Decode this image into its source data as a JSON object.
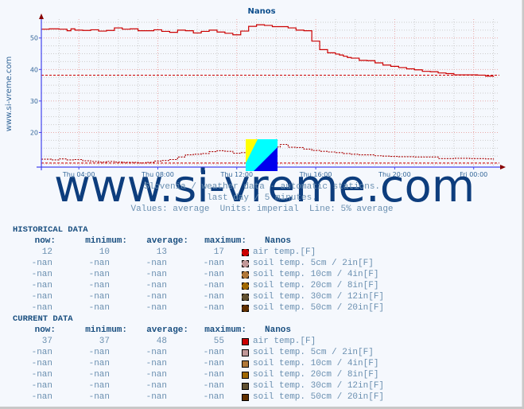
{
  "chart_data": {
    "type": "line",
    "title": "Nanos",
    "side_label": "www.si-vreme.com",
    "ylim": [
      9,
      56
    ],
    "yticks": [
      20,
      30,
      40,
      50
    ],
    "x_ticks": [
      "Thu 04:00",
      "Thu 08:00",
      "Thu 12:00",
      "Thu 16:00",
      "Thu 20:00",
      "Fri 00:00"
    ],
    "x_tick_hours": [
      4,
      8,
      12,
      16,
      20,
      24
    ],
    "x_range_hours": [
      2.1,
      25.3
    ],
    "grid": true,
    "series": [
      {
        "name": "air temp. current",
        "style": "solid",
        "color": "#cc0000",
        "hours": [
          2.1,
          2.5,
          3.0,
          3.4,
          3.6,
          3.8,
          4.2,
          4.6,
          5.0,
          5.4,
          5.8,
          6.2,
          6.6,
          7.0,
          7.4,
          7.8,
          8.2,
          8.6,
          9.0,
          9.4,
          9.8,
          10.2,
          10.6,
          11.0,
          11.4,
          11.8,
          12.2,
          12.6,
          13.0,
          13.4,
          13.8,
          14.2,
          14.6,
          15.0,
          15.4,
          15.8,
          16.2,
          16.6,
          17.0,
          17.2,
          17.4,
          17.6,
          17.8,
          18.2,
          18.6,
          19.0,
          19.4,
          19.8,
          20.2,
          20.6,
          21.0,
          21.4,
          21.8,
          22.2,
          22.6,
          23.0,
          23.4,
          23.8,
          24.2,
          24.6,
          25.0
        ],
        "values": [
          52.8,
          52.9,
          52.8,
          52.3,
          52.9,
          52.5,
          52.4,
          52.6,
          52.2,
          52.4,
          53.2,
          52.8,
          52.9,
          52.3,
          52.3,
          52.6,
          52.1,
          51.8,
          52.5,
          52.3,
          51.6,
          52.1,
          52.5,
          51.9,
          51.5,
          51.0,
          52.2,
          53.7,
          54.2,
          54.0,
          53.6,
          53.6,
          53.2,
          52.5,
          52.3,
          49.0,
          46.3,
          45.3,
          44.9,
          44.6,
          44.2,
          43.8,
          43.6,
          42.9,
          42.8,
          42.1,
          41.4,
          41.0,
          40.6,
          40.2,
          39.9,
          39.4,
          39.3,
          38.9,
          38.7,
          38.3,
          38.3,
          38.3,
          38.2,
          37.9,
          37.7
        ]
      },
      {
        "name": "air temp. historical",
        "style": "dotted",
        "color": "#aa0000",
        "hours": [
          2.1,
          2.6,
          3.0,
          3.4,
          3.8,
          4.2,
          4.6,
          5.0,
          5.4,
          5.8,
          6.2,
          6.6,
          7.0,
          7.4,
          7.8,
          8.2,
          8.6,
          9.0,
          9.4,
          9.8,
          10.2,
          10.6,
          11.0,
          11.4,
          11.8,
          12.2,
          12.6,
          13.0,
          13.4,
          13.8,
          14.2,
          14.6,
          15.0,
          15.4,
          15.8,
          16.2,
          16.6,
          17.0,
          17.4,
          17.8,
          18.2,
          18.6,
          19.0,
          19.4,
          19.8,
          20.2,
          20.6,
          21.0,
          21.4,
          21.8,
          22.2,
          22.6,
          23.0,
          23.4,
          23.8,
          24.2,
          24.6,
          25.0
        ],
        "values": [
          11.5,
          11.3,
          11.6,
          11.3,
          11.4,
          11.0,
          10.8,
          10.6,
          10.8,
          10.6,
          10.5,
          10.5,
          10.3,
          10.5,
          10.9,
          11.1,
          11.4,
          12.2,
          12.9,
          13.1,
          13.3,
          13.9,
          14.2,
          14.0,
          13.4,
          13.6,
          15.6,
          16.3,
          15.8,
          15.4,
          16.2,
          15.3,
          15.2,
          14.7,
          14.3,
          14.0,
          13.8,
          13.6,
          13.3,
          13.1,
          12.9,
          12.9,
          12.6,
          12.5,
          12.4,
          12.3,
          12.3,
          12.2,
          12.2,
          12.2,
          11.7,
          11.7,
          11.8,
          11.8,
          11.7,
          11.7,
          11.6,
          11.4
        ]
      },
      {
        "name": "current average (5%)",
        "style": "dashed",
        "color": "#cc0000",
        "constant": 38.2
      },
      {
        "name": "historical average (5%)",
        "style": "dashed",
        "color": "#cc0000",
        "constant": 10.3
      }
    ]
  },
  "captions": {
    "line1": "Slovenia / weather data - automatic stations.",
    "line2": "last day / 5 minutes.",
    "line3": "Values: average  Units: imperial  Line: 5% average"
  },
  "watermark": "www.si-vreme.com",
  "historical": {
    "title": "HISTORICAL DATA",
    "headers": [
      "now:",
      "minimum:",
      "average:",
      "maximum:",
      "Nanos"
    ],
    "rows": [
      {
        "now": "12",
        "min": "10",
        "avg": "13",
        "max": "17",
        "color": "#cc0000",
        "label": "air temp.[F]"
      },
      {
        "now": "-nan",
        "min": "-nan",
        "avg": "-nan",
        "max": "-nan",
        "color": "#c09898",
        "label": "soil temp. 5cm / 2in[F]"
      },
      {
        "now": "-nan",
        "min": "-nan",
        "avg": "-nan",
        "max": "-nan",
        "color": "#b07838",
        "label": "soil temp. 10cm / 4in[F]"
      },
      {
        "now": "-nan",
        "min": "-nan",
        "avg": "-nan",
        "max": "-nan",
        "color": "#a06800",
        "label": "soil temp. 20cm / 8in[F]"
      },
      {
        "now": "-nan",
        "min": "-nan",
        "avg": "-nan",
        "max": "-nan",
        "color": "#605030",
        "label": "soil temp. 30cm / 12in[F]"
      },
      {
        "now": "-nan",
        "min": "-nan",
        "avg": "-nan",
        "max": "-nan",
        "color": "#603000",
        "label": "soil temp. 50cm / 20in[F]"
      }
    ]
  },
  "current": {
    "title": "CURRENT DATA",
    "headers": [
      "now:",
      "minimum:",
      "average:",
      "maximum:",
      "Nanos"
    ],
    "rows": [
      {
        "now": "37",
        "min": "37",
        "avg": "48",
        "max": "55",
        "color": "#cc0000",
        "label": "air temp.[F]"
      },
      {
        "now": "-nan",
        "min": "-nan",
        "avg": "-nan",
        "max": "-nan",
        "color": "#c09898",
        "label": "soil temp. 5cm / 2in[F]"
      },
      {
        "now": "-nan",
        "min": "-nan",
        "avg": "-nan",
        "max": "-nan",
        "color": "#b07838",
        "label": "soil temp. 10cm / 4in[F]"
      },
      {
        "now": "-nan",
        "min": "-nan",
        "avg": "-nan",
        "max": "-nan",
        "color": "#a06800",
        "label": "soil temp. 20cm / 8in[F]"
      },
      {
        "now": "-nan",
        "min": "-nan",
        "avg": "-nan",
        "max": "-nan",
        "color": "#605030",
        "label": "soil temp. 30cm / 12in[F]"
      },
      {
        "now": "-nan",
        "min": "-nan",
        "avg": "-nan",
        "max": "-nan",
        "color": "#603000",
        "label": "soil temp. 50cm / 20in[F]"
      }
    ]
  }
}
